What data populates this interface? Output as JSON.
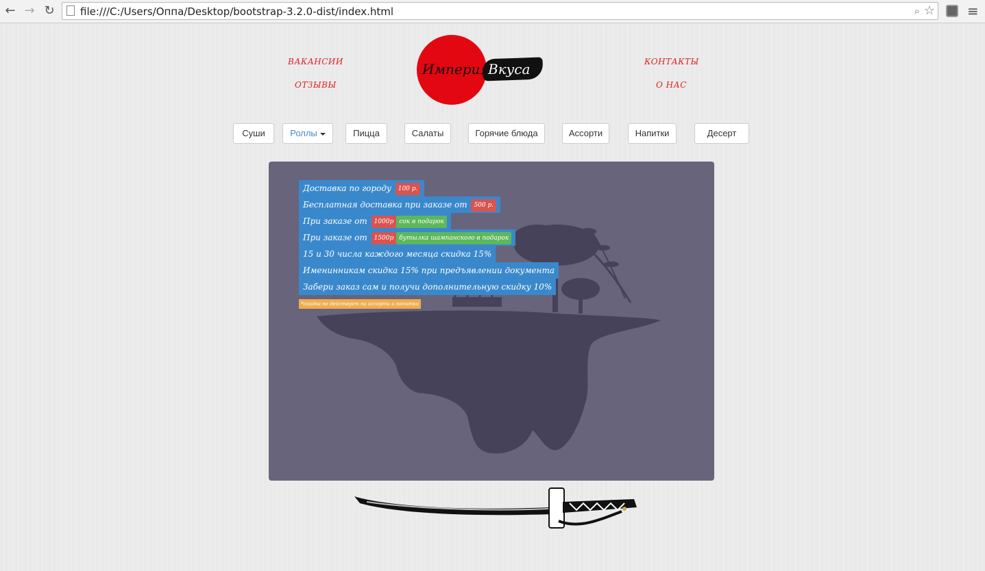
{
  "browser": {
    "url": "file:///C:/Users/Оппа/Desktop/bootstrap-3.2.0-dist/index.html"
  },
  "header": {
    "links": {
      "vacancies": "ВАКАНСИИ",
      "reviews": "ОТЗЫВЫ",
      "contacts": "КОНТАКТЫ",
      "about": "О НАС"
    },
    "logo": {
      "word1": "Империя",
      "word2": "Вкуса",
      "circle_color": "#e30711"
    }
  },
  "menu": {
    "items": [
      {
        "label": "Суши"
      },
      {
        "label": "Роллы",
        "dropdown": true,
        "active": true
      },
      {
        "label": "Пицца"
      },
      {
        "label": "Салаты"
      },
      {
        "label": "Горячие блюда"
      },
      {
        "label": "Ассорти"
      },
      {
        "label": "Напитки"
      },
      {
        "label": "Десерт"
      }
    ]
  },
  "promo": {
    "lines": [
      {
        "text": "Доставка по городу",
        "labels": [
          {
            "text": "100 р.",
            "color": "red"
          }
        ]
      },
      {
        "text": "Бесплатная доставка при заказе от",
        "labels": [
          {
            "text": "500 р.",
            "color": "red"
          }
        ]
      },
      {
        "text": "При заказе от",
        "labels": [
          {
            "text": "1000р",
            "color": "red"
          },
          {
            "text": "сок в подарок",
            "color": "green"
          }
        ]
      },
      {
        "text": "При заказе от",
        "labels": [
          {
            "text": "1500р",
            "color": "red"
          },
          {
            "text": "бутылка шампанского в подарок",
            "color": "green"
          }
        ]
      },
      {
        "text": "15 и 30 числа каждого месяца скидка 15%",
        "labels": []
      },
      {
        "text": "Именинникам скидка 15% при предъявлении документа",
        "labels": []
      },
      {
        "text": "Забери заказ сам и получи дополнительную скидку 10%",
        "labels": []
      }
    ],
    "footnote": "*скидка не действует на ассорти и напитки",
    "colors": {
      "panel": "#67647c",
      "line": "#3a88cc",
      "red": "#d9534f",
      "green": "#5cb85c",
      "footnote": "#f0ad4e"
    }
  }
}
